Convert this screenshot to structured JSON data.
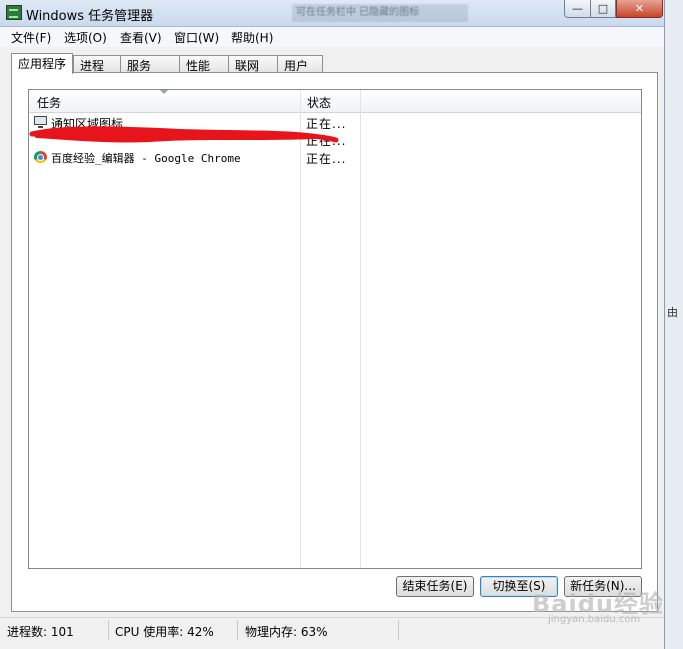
{
  "window": {
    "title": "Windows 任务管理器",
    "blurred_background_text": "可在任务栏中 已隐藏的图标"
  },
  "controls": {
    "minimize": "—",
    "maximize": "□",
    "close": "✕"
  },
  "menu": [
    "文件(F)",
    "选项(O)",
    "查看(V)",
    "窗口(W)",
    "帮助(H)"
  ],
  "tabs": [
    "应用程序",
    "进程",
    "服务",
    "性能",
    "联网",
    "用户"
  ],
  "active_tab": "应用程序",
  "columns": {
    "task": "任务",
    "status": "状态"
  },
  "rows": [
    {
      "icon": "monitor-icon",
      "label": "通知区域图标",
      "status": "正在..."
    },
    {
      "icon": "redacted",
      "label": "",
      "status": "正在..."
    },
    {
      "icon": "chrome-icon",
      "label": "百度经验_编辑器 - Google Chrome",
      "status": "正在..."
    }
  ],
  "buttons": {
    "end_task": "结束任务(E)",
    "switch_to": "切换至(S)",
    "new_task": "新任务(N)..."
  },
  "status_bar": {
    "processes": "进程数: 101",
    "cpu": "CPU 使用率: 42%",
    "memory": "物理内存: 63%"
  },
  "side_text": "由",
  "watermark": {
    "logo": "Baidu经验",
    "url": "jingyan.baidu.com"
  },
  "colors": {
    "redaction": "#e8141b",
    "title_bar": "#c9d9ee",
    "close_button": "#c6452c"
  }
}
